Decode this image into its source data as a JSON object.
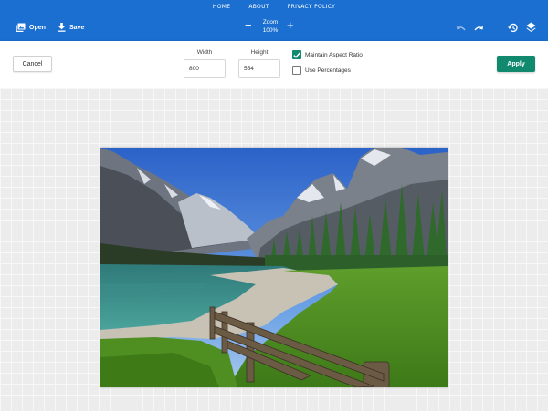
{
  "nav": {
    "items": [
      "HOME",
      "ABOUT",
      "PRIVACY POLICY"
    ]
  },
  "toolbar_top": {
    "open_label": "Open",
    "save_label": "Save",
    "zoom_label": "Zoom",
    "zoom_value": "100%"
  },
  "resize": {
    "cancel_label": "Cancel",
    "width_label": "Width",
    "width_value": "800",
    "height_label": "Height",
    "height_value": "554",
    "maintain_ratio_label": "Maintain Aspect Ratio",
    "maintain_ratio_checked": true,
    "use_percentages_label": "Use Percentages",
    "use_percentages_checked": false,
    "apply_label": "Apply"
  },
  "colors": {
    "topbar": "#1a6fd0",
    "accent": "#10896f"
  },
  "icons": {
    "open": "image-open-icon",
    "save": "download-icon",
    "zoom_out": "minus-icon",
    "zoom_in": "plus-icon",
    "undo": "undo-icon",
    "redo": "redo-icon",
    "history": "history-icon",
    "layers": "layers-icon"
  }
}
